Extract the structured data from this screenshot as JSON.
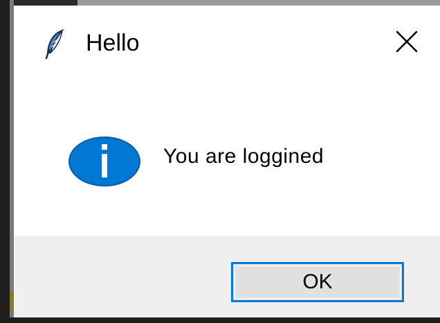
{
  "dialog": {
    "title": "Hello",
    "app_icon": "feather-icon",
    "close_icon": "close-icon",
    "message_icon": "info-icon",
    "message": "You are loggined",
    "ok_label": "OK"
  },
  "colors": {
    "info_icon": "#0078d4",
    "ok_border": "#0078d7",
    "footer_background": "#f0f0f0",
    "button_background": "#e1e1e1"
  }
}
